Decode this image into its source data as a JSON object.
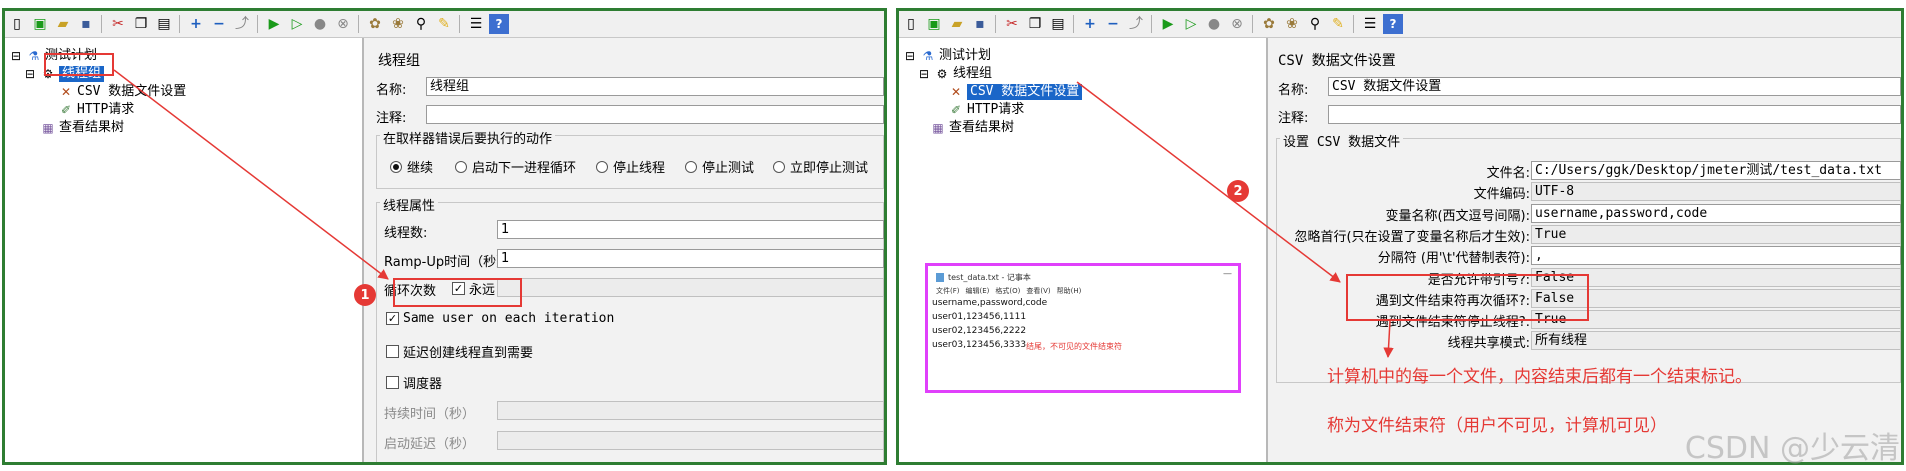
{
  "toolbar": {
    "icons": [
      "new-icon",
      "templates-icon",
      "open-icon",
      "save-icon",
      "cut-icon",
      "copy-icon",
      "paste-icon",
      "expand-icon",
      "collapse-icon",
      "toggle-icon",
      "start-icon",
      "start-no-pause-icon",
      "stop-icon",
      "shutdown-icon",
      "clear-icon",
      "clear-all-icon",
      "search-icon",
      "reset-search-icon",
      "function-helper-icon",
      "help-icon"
    ]
  },
  "left": {
    "tree": {
      "test_plan": "测试计划",
      "thread_group": "线程组",
      "csv_config": "CSV 数据文件设置",
      "http_request": "HTTP请求",
      "results_tree": "查看结果树"
    },
    "editor": {
      "title": "线程组",
      "name_label": "名称:",
      "name_value": "线程组",
      "comment_label": "注释:",
      "comment_value": "",
      "error_group_title": "在取样器错误后要执行的动作",
      "actions": [
        "继续",
        "启动下一进程循环",
        "停止线程",
        "停止测试",
        "立即停止测试"
      ],
      "thread_props_title": "线程属性",
      "threads_label": "线程数:",
      "threads_value": "1",
      "rampup_label": "Ramp-Up时间（秒）:",
      "rampup_value": "1",
      "loop_label": "循环次数",
      "forever_label": "永远",
      "same_user_label": "Same user on each iteration",
      "delay_label": "延迟创建线程直到需要",
      "scheduler_label": "调度器",
      "duration_label": "持续时间（秒）",
      "startup_delay_label": "启动延迟（秒）"
    },
    "badge": "1"
  },
  "right": {
    "tree": {
      "test_plan": "测试计划",
      "thread_group": "线程组",
      "csv_config": "CSV 数据文件设置",
      "http_request": "HTTP请求",
      "results_tree": "查看结果树"
    },
    "editor": {
      "title": "CSV 数据文件设置",
      "name_label": "名称:",
      "name_value": "CSV 数据文件设置",
      "comment_label": "注释:",
      "comment_value": "",
      "group_title": "设置 CSV 数据文件",
      "rows": [
        {
          "label": "文件名:",
          "value": "C:/Users/ggk/Desktop/jmeter测试/test_data.txt"
        },
        {
          "label": "文件编码:",
          "value": "UTF-8"
        },
        {
          "label": "变量名称(西文逗号间隔):",
          "value": "username,password,code"
        },
        {
          "label": "忽略首行(只在设置了变量名称后才生效):",
          "value": "True"
        },
        {
          "label": "分隔符 (用'\\t'代替制表符):",
          "value": ","
        },
        {
          "label": "是否允许带引号?:",
          "value": "False"
        },
        {
          "label": "遇到文件结束符再次循环?:",
          "value": "False"
        },
        {
          "label": "遇到文件结束符停止线程?:",
          "value": "True"
        },
        {
          "label": "线程共享模式:",
          "value": "所有线程"
        }
      ]
    },
    "badge": "2",
    "notepad": {
      "title": "test_data.txt - 记事本",
      "menu": [
        "文件(F)",
        "编辑(E)",
        "格式(O)",
        "查看(V)",
        "帮助(H)"
      ],
      "lines": [
        "username,password,code",
        "user01,123456,1111",
        "user02,123456,2222",
        "user03,123456,3333"
      ],
      "eof_note": "结尾，不可见的文件结束符"
    },
    "note_line1": "计算机中的每一个文件，内容结束后都有一个结束标记。",
    "note_line2": "称为文件结束符（用户不可见，计算机可见）",
    "watermark": "CSDN @少云清"
  },
  "colors": {
    "panel_border": "#2e7d32",
    "annotation_red": "#e53935",
    "selection_blue": "#1a66c8",
    "notepad_border": "#e040fb"
  }
}
